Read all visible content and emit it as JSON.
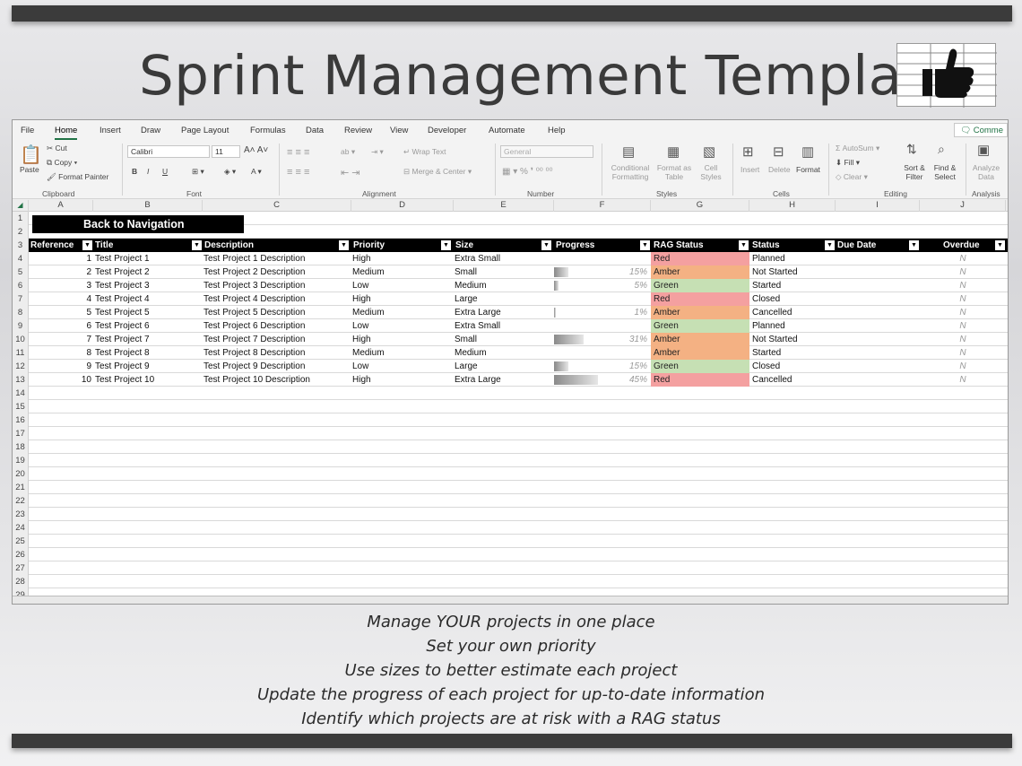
{
  "title": "Sprint Management Template",
  "menu": {
    "tabs": [
      "File",
      "Home",
      "Insert",
      "Draw",
      "Page Layout",
      "Formulas",
      "Data",
      "Review",
      "View",
      "Developer",
      "Automate",
      "Help"
    ],
    "active_tab": "Home",
    "comments_label": "Comme"
  },
  "ribbon": {
    "clipboard": {
      "paste": "Paste",
      "cut": "Cut",
      "copy": "Copy",
      "format_painter": "Format Painter",
      "label": "Clipboard"
    },
    "font": {
      "name": "Calibri",
      "size": "11",
      "label": "Font"
    },
    "alignment": {
      "wrap_text": "Wrap Text",
      "merge_center": "Merge & Center",
      "label": "Alignment"
    },
    "number": {
      "format": "General",
      "label": "Number"
    },
    "styles": {
      "conditional": "Conditional Formatting",
      "format_table": "Format as Table",
      "cell_styles": "Cell Styles",
      "label": "Styles"
    },
    "cells": {
      "insert": "Insert",
      "delete": "Delete",
      "format": "Format",
      "label": "Cells"
    },
    "editing": {
      "autosum": "AutoSum",
      "fill": "Fill",
      "clear": "Clear",
      "sort_filter": "Sort & Filter",
      "find_select": "Find & Select",
      "label": "Editing"
    },
    "analysis": {
      "analyze": "Analyze Data",
      "label": "Analysis"
    }
  },
  "columns": [
    "A",
    "B",
    "C",
    "D",
    "E",
    "F",
    "G",
    "H",
    "I",
    "J"
  ],
  "rows": [
    "1",
    "2",
    "3",
    "4",
    "5",
    "6",
    "7",
    "8",
    "9",
    "10",
    "11",
    "12",
    "13",
    "14",
    "15",
    "16",
    "17",
    "18",
    "19",
    "20",
    "21",
    "22",
    "23",
    "24",
    "25",
    "26",
    "27",
    "28",
    "29"
  ],
  "back_button": "Back to Navigation",
  "table_headers": [
    "Reference",
    "Title",
    "Description",
    "Priority",
    "Size",
    "Progress",
    "RAG Status",
    "Status",
    "Due Date",
    "Overdue"
  ],
  "rag_colors": {
    "Red": "#f4a0a0",
    "Amber": "#f4b183",
    "Green": "#c6e0b4"
  },
  "table_rows": [
    {
      "ref": "1",
      "title": "Test Project 1",
      "desc": "Test Project 1 Description",
      "priority": "High",
      "size": "Extra Small",
      "progress": 0,
      "progress_label": "",
      "rag": "Red",
      "status": "Planned",
      "overdue": "N"
    },
    {
      "ref": "2",
      "title": "Test Project 2",
      "desc": "Test Project 2 Description",
      "priority": "Medium",
      "size": "Small",
      "progress": 15,
      "progress_label": "15%",
      "rag": "Amber",
      "status": "Not Started",
      "overdue": "N"
    },
    {
      "ref": "3",
      "title": "Test Project 3",
      "desc": "Test Project 3 Description",
      "priority": "Low",
      "size": "Medium",
      "progress": 5,
      "progress_label": "5%",
      "rag": "Green",
      "status": "Started",
      "overdue": "N"
    },
    {
      "ref": "4",
      "title": "Test Project 4",
      "desc": "Test Project 4 Description",
      "priority": "High",
      "size": "Large",
      "progress": 0,
      "progress_label": "",
      "rag": "Red",
      "status": "Closed",
      "overdue": "N"
    },
    {
      "ref": "5",
      "title": "Test Project 5",
      "desc": "Test Project 5 Description",
      "priority": "Medium",
      "size": "Extra Large",
      "progress": 1,
      "progress_label": "1%",
      "rag": "Amber",
      "status": "Cancelled",
      "overdue": "N"
    },
    {
      "ref": "6",
      "title": "Test Project 6",
      "desc": "Test Project 6 Description",
      "priority": "Low",
      "size": "Extra Small",
      "progress": 0,
      "progress_label": "",
      "rag": "Green",
      "status": "Planned",
      "overdue": "N"
    },
    {
      "ref": "7",
      "title": "Test Project 7",
      "desc": "Test Project 7 Description",
      "priority": "High",
      "size": "Small",
      "progress": 31,
      "progress_label": "31%",
      "rag": "Amber",
      "status": "Not Started",
      "overdue": "N"
    },
    {
      "ref": "8",
      "title": "Test Project 8",
      "desc": "Test Project 8 Description",
      "priority": "Medium",
      "size": "Medium",
      "progress": 0,
      "progress_label": "",
      "rag": "Amber",
      "status": "Started",
      "overdue": "N"
    },
    {
      "ref": "9",
      "title": "Test Project 9",
      "desc": "Test Project 9 Description",
      "priority": "Low",
      "size": "Large",
      "progress": 15,
      "progress_label": "15%",
      "rag": "Green",
      "status": "Closed",
      "overdue": "N"
    },
    {
      "ref": "10",
      "title": "Test Project 10",
      "desc": "Test Project 10 Description",
      "priority": "High",
      "size": "Extra Large",
      "progress": 45,
      "progress_label": "45%",
      "rag": "Red",
      "status": "Cancelled",
      "overdue": "N"
    }
  ],
  "captions": [
    "Manage YOUR projects in one place",
    "Set your own priority",
    "Use sizes to better estimate each project",
    "Update the progress of each project for up-to-date information",
    "Identify which projects are at risk with a RAG status"
  ]
}
